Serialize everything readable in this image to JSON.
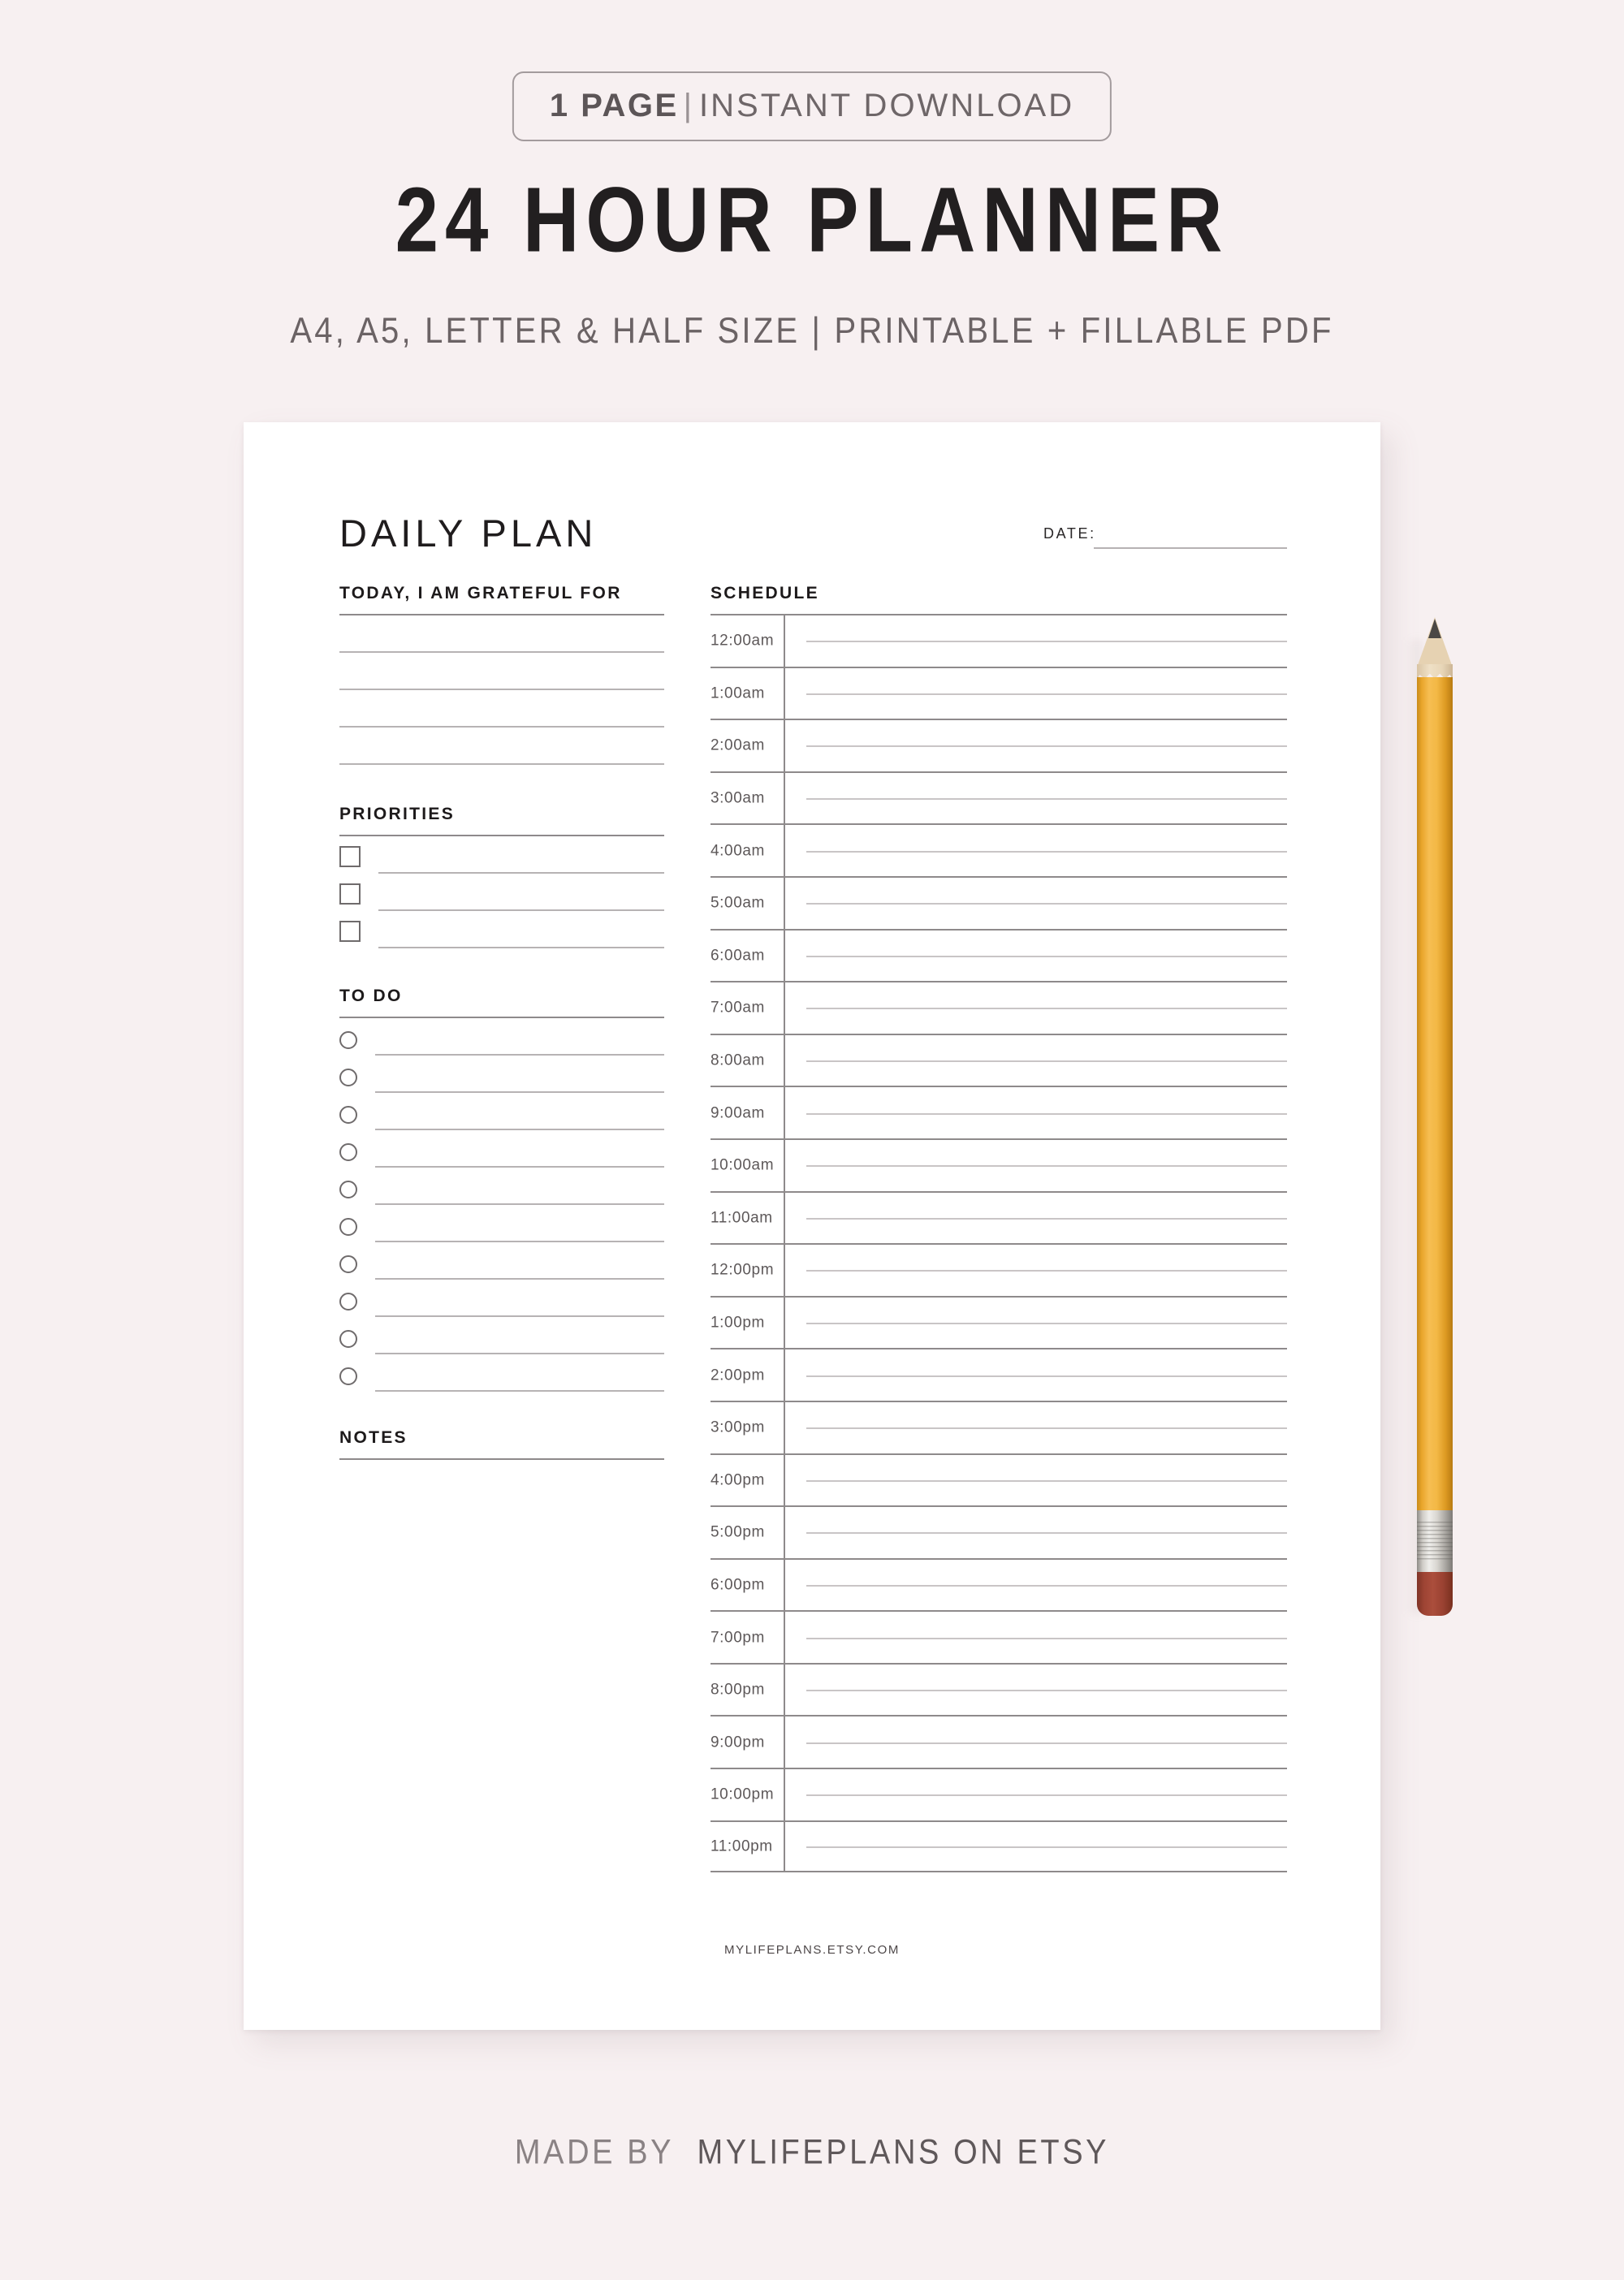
{
  "promo": {
    "badge_strong": "1 PAGE",
    "badge_pipe": "|",
    "badge_rest": "INSTANT DOWNLOAD",
    "title": "24 HOUR PLANNER",
    "subtitle": "A4, A5, LETTER & HALF SIZE | PRINTABLE + FILLABLE PDF"
  },
  "sheet": {
    "title": "DAILY PLAN",
    "date_label": "DATE:",
    "footer": "MYLIFEPLANS.ETSY.COM",
    "sections": {
      "gratitude": {
        "heading": "TODAY, I AM GRATEFUL FOR",
        "line_count": 4
      },
      "priorities": {
        "heading": "PRIORITIES",
        "item_count": 3,
        "marker": "checkbox-icon"
      },
      "todo": {
        "heading": "TO DO",
        "item_count": 10,
        "marker": "circle-icon"
      },
      "notes": {
        "heading": "NOTES"
      },
      "schedule": {
        "heading": "SCHEDULE",
        "times": [
          "12:00am",
          "1:00am",
          "2:00am",
          "3:00am",
          "4:00am",
          "5:00am",
          "6:00am",
          "7:00am",
          "8:00am",
          "9:00am",
          "10:00am",
          "11:00am",
          "12:00pm",
          "1:00pm",
          "2:00pm",
          "3:00pm",
          "4:00pm",
          "5:00pm",
          "6:00pm",
          "7:00pm",
          "8:00pm",
          "9:00pm",
          "10:00pm",
          "11:00pm"
        ]
      }
    }
  },
  "pencil": {
    "name": "pencil-prop"
  },
  "banner": {
    "made_by_prefix": "MADE BY",
    "made_by_brand": "MYLIFEPLANS ON ETSY"
  },
  "colors": {
    "page_background": "#f7f0f1",
    "paper": "#ffffff",
    "ink": "#1d1a1b",
    "muted_ink": "#6b6365",
    "rule_strong": "#8e8a8b",
    "rule_light": "#b7b3b4",
    "rule_faint": "#c9c5c6",
    "pencil_body": "#f3b845",
    "pencil_eraser": "#9b4232"
  }
}
